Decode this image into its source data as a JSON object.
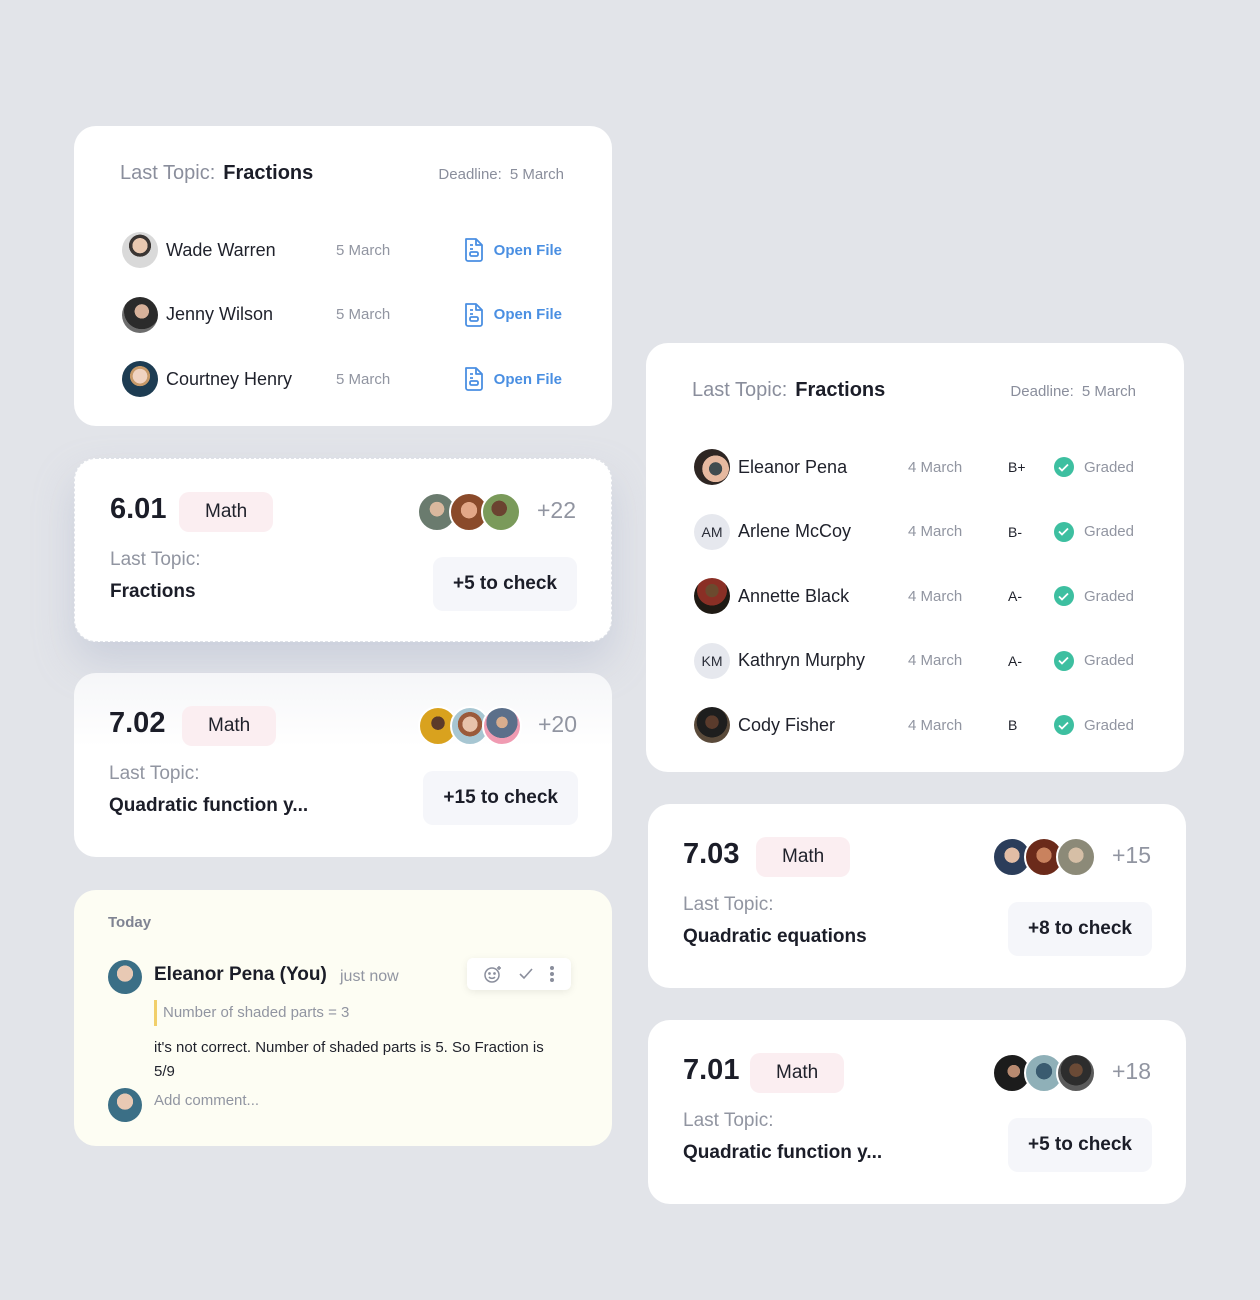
{
  "colors": {
    "background": "#e2e4e9",
    "accent_blue": "#4a8fe2",
    "graded_green": "#3dbfa0",
    "pill_pink": "#fbeef1",
    "quote_yellow": "#f1cf6a",
    "comment_bg": "#fdfdf3"
  },
  "submissions_card": {
    "last_topic_label": "Last Topic:",
    "last_topic": "Fractions",
    "deadline_label": "Deadline:",
    "deadline": "5 March",
    "rows": [
      {
        "name": "Wade Warren",
        "date": "5 March",
        "action": "Open File",
        "icon": "file-icon"
      },
      {
        "name": "Jenny Wilson",
        "date": "5 March",
        "action": "Open File",
        "icon": "file-icon"
      },
      {
        "name": "Courtney Henry",
        "date": "5 March",
        "action": "Open File",
        "icon": "file-icon"
      }
    ]
  },
  "grades_card": {
    "last_topic_label": "Last Topic:",
    "last_topic": "Fractions",
    "deadline_label": "Deadline:",
    "deadline": "5 March",
    "rows": [
      {
        "name": "Eleanor Pena",
        "initials": "",
        "date": "4 March",
        "grade": "B+",
        "status": "Graded"
      },
      {
        "name": "Arlene McCoy",
        "initials": "AM",
        "date": "4 March",
        "grade": "B-",
        "status": "Graded"
      },
      {
        "name": "Annette Black",
        "initials": "",
        "date": "4 March",
        "grade": "A-",
        "status": "Graded"
      },
      {
        "name": "Kathryn Murphy",
        "initials": "KM",
        "date": "4 March",
        "grade": "A-",
        "status": "Graded"
      },
      {
        "name": "Cody Fisher",
        "initials": "",
        "date": "4 March",
        "grade": "B",
        "status": "Graded"
      }
    ]
  },
  "classes": [
    {
      "id": "6.01",
      "subject": "Math",
      "last_topic_label": "Last Topic:",
      "last_topic": "Fractions",
      "extra_students": "+22",
      "to_check": "+5 to check"
    },
    {
      "id": "7.02",
      "subject": "Math",
      "last_topic_label": "Last Topic:",
      "last_topic": "Quadratic function y...",
      "extra_students": "+20",
      "to_check": "+15 to check"
    },
    {
      "id": "7.03",
      "subject": "Math",
      "last_topic_label": "Last Topic:",
      "last_topic": "Quadratic equations",
      "extra_students": "+15",
      "to_check": "+8 to check"
    },
    {
      "id": "7.01",
      "subject": "Math",
      "last_topic_label": "Last Topic:",
      "last_topic": "Quadratic function y...",
      "extra_students": "+18",
      "to_check": "+5 to check"
    }
  ],
  "comment_card": {
    "section_label": "Today",
    "author": "Eleanor Pena (You)",
    "time": "just now",
    "quote": "Number of shaded parts = 3",
    "text": "it's not correct. Number of shaded parts is 5. So Fraction is 5/9",
    "input_placeholder": "Add comment...",
    "actions": [
      "add-reaction-icon",
      "resolve-check-icon",
      "more-options-icon"
    ]
  }
}
